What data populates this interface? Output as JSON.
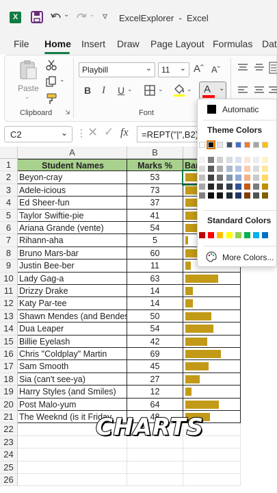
{
  "titlebar": {
    "title": "ExcelExplorer  -  Excel",
    "qat_more": "▿"
  },
  "tabs": [
    "File",
    "Home",
    "Insert",
    "Draw",
    "Page Layout",
    "Formulas",
    "Data"
  ],
  "ribbon": {
    "paste_label": "Paste",
    "font_name": "Playbill",
    "font_size": "11",
    "grow_font": "Aˆ",
    "shrink_font": "Aˇ",
    "bold": "B",
    "italic": "I",
    "underline": "U",
    "font_color_glyph": "A",
    "clipboard_group": "Clipboard",
    "font_group": "Font"
  },
  "formula_bar": {
    "name_box": "C2",
    "formula": "=REPT(\"|\",B2)",
    "fx": "fx"
  },
  "columns": [
    "A",
    "B"
  ],
  "headers": {
    "a": "Student Names",
    "b": "Marks %",
    "c": "Bar"
  },
  "rows": [
    {
      "n": "2",
      "name": "Beyon-cray",
      "mark": "53",
      "v": 53
    },
    {
      "n": "3",
      "name": "Adele-icious",
      "mark": "73",
      "v": 73
    },
    {
      "n": "4",
      "name": "Ed Sheer-fun",
      "mark": "37",
      "v": 37
    },
    {
      "n": "5",
      "name": "Taylor Swiftie-pie",
      "mark": "41",
      "v": 41
    },
    {
      "n": "6",
      "name": "Ariana Grande (vente)",
      "mark": "54",
      "v": 54
    },
    {
      "n": "7",
      "name": "Rihann-aha",
      "mark": "5",
      "v": 5
    },
    {
      "n": "8",
      "name": "Bruno Mars-bar",
      "mark": "60",
      "v": 60
    },
    {
      "n": "9",
      "name": "Justin Bee-ber",
      "mark": "11",
      "v": 11
    },
    {
      "n": "10",
      "name": "Lady Gag-a",
      "mark": "63",
      "v": 63
    },
    {
      "n": "11",
      "name": "Drizzy Drake",
      "mark": "14",
      "v": 14
    },
    {
      "n": "12",
      "name": "Katy Par-tee",
      "mark": "14",
      "v": 14
    },
    {
      "n": "13",
      "name": "Shawn Mendes (and Bendes)",
      "mark": "50",
      "v": 50
    },
    {
      "n": "14",
      "name": "Dua Leaper",
      "mark": "54",
      "v": 54
    },
    {
      "n": "15",
      "name": "Billie Eyelash",
      "mark": "42",
      "v": 42
    },
    {
      "n": "16",
      "name": "Chris \"Coldplay\" Martin",
      "mark": "69",
      "v": 69
    },
    {
      "n": "17",
      "name": "Sam Smooth",
      "mark": "45",
      "v": 45
    },
    {
      "n": "18",
      "name": "Sia (can't see-ya)",
      "mark": "27",
      "v": 27
    },
    {
      "n": "19",
      "name": "Harry Styles (and Smiles)",
      "mark": "12",
      "v": 12
    },
    {
      "n": "20",
      "name": "Post Malo-yum",
      "mark": "64",
      "v": 64
    },
    {
      "n": "21",
      "name": "The Weeknd (is it Friday",
      "mark": "48",
      "v": 48
    }
  ],
  "empty_rows": [
    "22",
    "23",
    "24",
    "25",
    "26"
  ],
  "header_row_num": "1",
  "color_popup": {
    "automatic": "Automatic",
    "theme_title": "Theme Colors",
    "standard_title": "Standard Colors",
    "more": "More Colors...",
    "theme_top": [
      "#ffffff",
      "#000000",
      "#e7e6e6",
      "#44546a",
      "#4472c4",
      "#ed7d31",
      "#a5a5a5",
      "#ffc000"
    ],
    "theme_cols": [
      [
        "#f2f2f2",
        "#d9d9d9",
        "#bfbfbf",
        "#a6a6a6",
        "#808080"
      ],
      [
        "#808080",
        "#595959",
        "#404040",
        "#262626",
        "#0d0d0d"
      ],
      [
        "#d0cece",
        "#aeaaaa",
        "#757171",
        "#3a3838",
        "#171616"
      ],
      [
        "#d6dce4",
        "#adb9ca",
        "#8497b0",
        "#333f4f",
        "#222a35"
      ],
      [
        "#d9e1f2",
        "#b4c6e7",
        "#8ea9db",
        "#305496",
        "#203764"
      ],
      [
        "#fce4d6",
        "#f8cbad",
        "#f4b084",
        "#c65911",
        "#833c0c"
      ],
      [
        "#ededed",
        "#dbdbdb",
        "#c9c9c9",
        "#7b7b7b",
        "#525252"
      ],
      [
        "#fff2cc",
        "#ffe699",
        "#ffd966",
        "#bf8f00",
        "#806000"
      ]
    ],
    "standard": [
      "#c00000",
      "#ff0000",
      "#ffc000",
      "#ffff00",
      "#92d050",
      "#00b050",
      "#00b0f0",
      "#0070c0"
    ]
  },
  "overlay_caption": "CHARTS",
  "colors": {
    "header_green": "#a9d18e",
    "bar_gold": "#c39a17",
    "excel_green": "#107c41"
  }
}
